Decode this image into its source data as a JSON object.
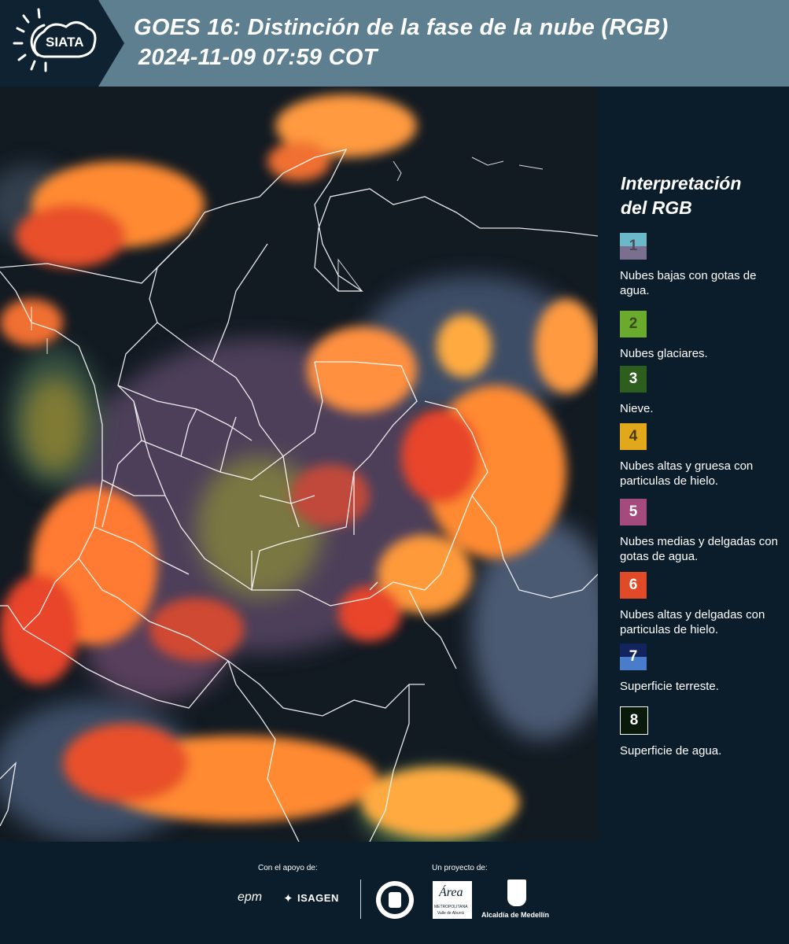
{
  "header": {
    "logo_text": "SIATA",
    "title_line1": "GOES 16: Distinción de la fase de la nube (RGB)",
    "title_line2": "2024-11-09 07:59 COT"
  },
  "legend": {
    "title_line1": "Interpretación",
    "title_line2": "del RGB",
    "items": [
      {
        "number": "1",
        "label": "Nubes bajas con gotas de agua.",
        "color_top": "#6ab8c8",
        "color_bottom": "#7b6f8f",
        "text_color": "#4a4a5a"
      },
      {
        "number": "2",
        "label": "Nubes glaciares.",
        "color_top": "#6aab2e",
        "color_bottom": "#6aab2e",
        "text_color": "#3a4a20"
      },
      {
        "number": "3",
        "label": "Nieve.",
        "color_top": "#2d5e1e",
        "color_bottom": "#2d5e1e",
        "text_color": "#ffffff"
      },
      {
        "number": "4",
        "label": "Nubes altas y gruesa con particulas de hielo.",
        "color_top": "#e2a81c",
        "color_bottom": "#e2a81c",
        "text_color": "#4a3a10"
      },
      {
        "number": "5",
        "label": "Nubes medias y delgadas con gotas de agua.",
        "color_top": "#a54a7c",
        "color_bottom": "#a54a7c",
        "text_color": "#ffffff"
      },
      {
        "number": "6",
        "label": "Nubes altas y delgadas con particulas de hielo.",
        "color_top": "#e04a26",
        "color_bottom": "#e04a26",
        "text_color": "#ffffff"
      },
      {
        "number": "7",
        "label": "Superficie terreste.",
        "color_top": "#12235e",
        "color_bottom": "#4a7ccc",
        "text_color": "#ffffff"
      },
      {
        "number": "8",
        "label": "Superficie de agua.",
        "color_top": "#0a1a0a",
        "color_bottom": "#0a1a0a",
        "text_color": "#ffffff"
      }
    ]
  },
  "footer": {
    "support_label": "Con el apoyo de:",
    "project_label": "Un proyecto de:",
    "epm": "epm",
    "isagen": "ISAGEN",
    "area_text": "Área",
    "area_sub1": "METROPOLITANA",
    "area_sub2": "Valle de Aburrá",
    "alcaldia": "Alcaldía de Medellín"
  },
  "colors": {
    "header_bg": "#5d7f8f",
    "panel_bg": "#0b1c2a",
    "cloud_orange": "#ff8a30",
    "cloud_red": "#e8442a",
    "cloud_purple": "#7a5a7a",
    "border_line": "#ffffff"
  }
}
